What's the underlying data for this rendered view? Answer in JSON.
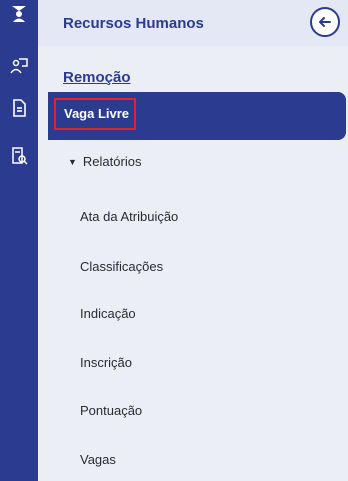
{
  "header": {
    "title": "Recursos Humanos"
  },
  "section": {
    "title": "Remoção"
  },
  "active_item": {
    "label": "Vaga Livre"
  },
  "group": {
    "label": "Relatórios",
    "items": [
      "Ata da Atribuição",
      "Classificações",
      "Indicação",
      "Inscrição",
      "Pontuação",
      "Vagas"
    ]
  },
  "rail": {
    "icons": [
      "graduation-user-icon",
      "presentation-user-icon",
      "document-icon",
      "document-search-icon"
    ],
    "active_index": 2
  },
  "colors": {
    "primary": "#2b3b8f",
    "panel_bg": "#eceef6",
    "highlight_border": "#e8202b"
  }
}
